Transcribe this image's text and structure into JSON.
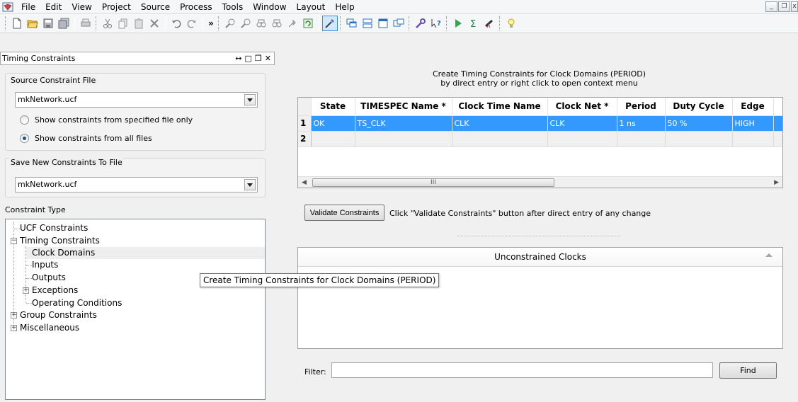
{
  "menubar": {
    "items": [
      "File",
      "Edit",
      "View",
      "Project",
      "Source",
      "Process",
      "Tools",
      "Window",
      "Layout",
      "Help"
    ],
    "window_buttons": [
      "_",
      "❐",
      "x"
    ]
  },
  "toolbar": {
    "icons": [
      "new-file-icon",
      "open-folder-icon",
      "save-icon",
      "save-all-icon",
      "print-icon",
      "cut-icon",
      "copy-icon",
      "paste-icon",
      "delete-icon",
      "undo-icon",
      "redo-icon",
      "more-icon",
      "find-icon",
      "find-next-icon",
      "binoculars-icon",
      "binoculars-next-icon",
      "bookmark-icon",
      "refresh-icon",
      "wizard-icon",
      "cascade-icon",
      "tile-horizontal-icon",
      "tile-vertical-icon",
      "restore-windows-icon",
      "wrench-icon",
      "help-pointer-icon",
      "run-icon",
      "sigma-icon",
      "telescope-icon",
      "lightbulb-icon"
    ],
    "more_label": "»"
  },
  "left_panel": {
    "title": "Timing Constraints",
    "controls": [
      "↔",
      "□",
      "❐",
      "✕"
    ],
    "source_group_label": "Source Constraint File",
    "source_file": "mkNetwork.ucf",
    "radio_specified": "Show constraints from specified file only",
    "radio_all": "Show constraints from all files",
    "selected_radio": "all",
    "save_group_label": "Save New Constraints To File",
    "save_file": "mkNetwork.ucf",
    "constraint_type_label": "Constraint Type",
    "tree": {
      "ucf": "UCF Constraints",
      "timing": "Timing Constraints",
      "clock_domains": "Clock Domains",
      "inputs": "Inputs",
      "outputs": "Outputs",
      "exceptions": "Exceptions",
      "operating_conditions": "Operating Conditions",
      "group": "Group Constraints",
      "misc": "Miscellaneous"
    }
  },
  "main": {
    "caption_line1": "Create Timing Constraints for Clock Domains (PERIOD)",
    "caption_line2": "by direct entry or right click to open context menu",
    "columns": [
      "State",
      "TIMESPEC Name *",
      "Clock Time Name",
      "Clock Net *",
      "Period",
      "Duty Cycle",
      "Edge"
    ],
    "rows": [
      {
        "num": "1",
        "cells": [
          "OK",
          "TS_CLK",
          "CLK",
          "CLK",
          "1 ns",
          "50 %",
          "HIGH"
        ]
      },
      {
        "num": "2",
        "cells": [
          "",
          "",
          "",
          "",
          "",
          "",
          ""
        ]
      }
    ],
    "scroll_thumb": "III",
    "validate_button": "Validate Constraints",
    "validate_hint": "Click \"Validate Constraints\" button after direct entry of any change",
    "unconstrained_header": "Unconstrained Clocks",
    "filter_label": "Filter:",
    "filter_value": "",
    "find_button": "Find"
  },
  "tooltip": "Create Timing Constraints for Clock Domains (PERIOD)",
  "colors": {
    "selection": "#3399ff",
    "panel_bg": "#f0f0f0"
  }
}
